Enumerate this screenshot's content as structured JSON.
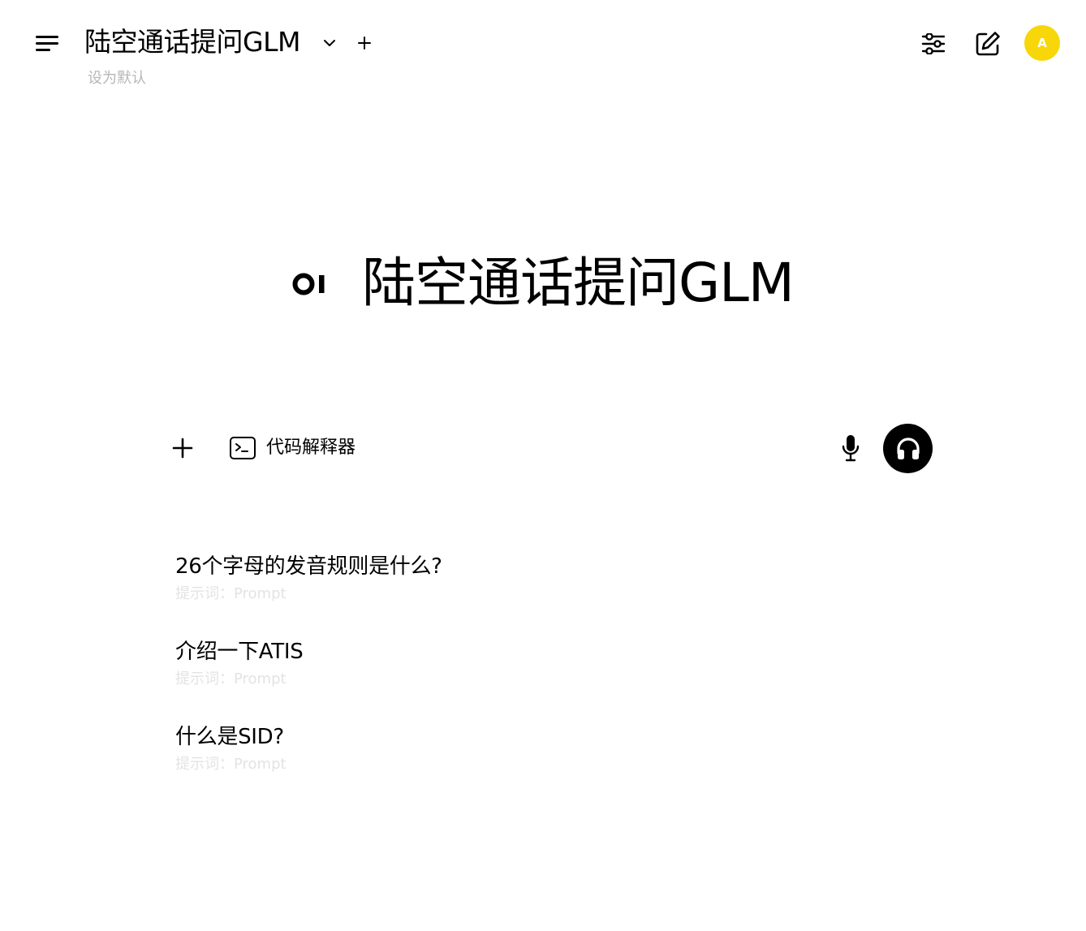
{
  "header": {
    "menu_icon": "hamburger-menu-icon",
    "model_name": "陆空通话提问GLM",
    "set_default_label": "设为默认",
    "controls_icon": "sliders-icon",
    "new_chat_icon": "pencil-square-icon",
    "avatar_initial": "A",
    "avatar_color": "#f7d70a"
  },
  "hero": {
    "logo_text": "OI logo",
    "title": "陆空通话提问GLM"
  },
  "input": {
    "attach_icon": "plus-icon",
    "code_interpreter_label": "代码解释器",
    "code_interpreter_icon": "terminal-icon",
    "mic_icon": "microphone-icon",
    "voice_icon": "headphones-icon"
  },
  "suggestions": [
    {
      "title": "26个字母的发音规则是什么?",
      "hint": "提示词：Prompt"
    },
    {
      "title": "介绍一下ATIS",
      "hint": "提示词：Prompt"
    },
    {
      "title": "什么是SID?",
      "hint": "提示词：Prompt"
    }
  ]
}
